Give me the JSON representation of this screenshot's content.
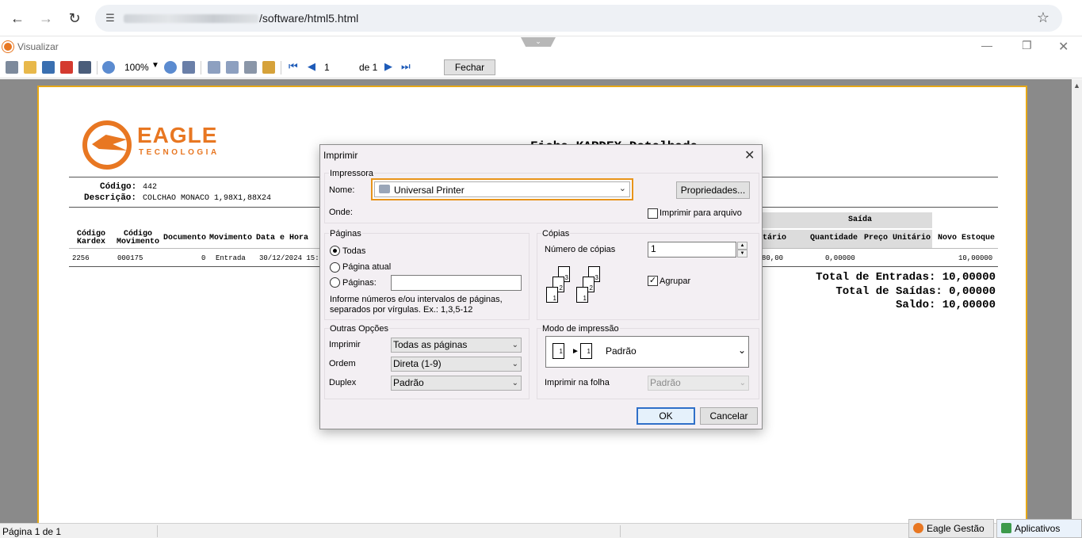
{
  "browser": {
    "url_visible": "/software/html5.html"
  },
  "app": {
    "window_title": "Visualizar"
  },
  "toolbar": {
    "zoom": "100%",
    "page_current": "1",
    "page_of": "de 1",
    "close_label": "Fechar"
  },
  "report": {
    "logo_word": "EAGLE",
    "logo_sub": "TECNOLOGIA",
    "title": "Ficha KARDEX Detalhada",
    "codigo_label": "Código:",
    "codigo_value": "442",
    "descricao_label": "Descrição:",
    "descricao_value": "COLCHAO MONACO 1,98X1,88X24",
    "band_saida": "Saída",
    "headers": {
      "codigo_kardex": "Código Kardex",
      "codigo_movimento": "Código Movimento",
      "documento": "Documento",
      "movimento": "Movimento",
      "data_hora": "Data e Hora",
      "unitario": "tário",
      "quantidade": "Quantidade",
      "preco_unitario": "Preço Unitário",
      "novo_estoque": "Novo Estoque"
    },
    "row": {
      "codigo_kardex": "2256",
      "codigo_movimento": "000175",
      "documento": "0",
      "movimento": "Entrada",
      "data_hora": "30/12/2024 15:",
      "unitario": "80,00",
      "quantidade": "0,00000",
      "novo_estoque": "10,00000"
    },
    "totals": {
      "entradas": "Total de Entradas: 10,00000",
      "saidas": "Total de Saídas: 0,00000",
      "saldo": "Saldo: 10,00000"
    }
  },
  "dialog": {
    "title": "Imprimir",
    "impressora_group": "Impressora",
    "nome_label": "Nome:",
    "printer_name": "Universal Printer",
    "propriedades_label": "Propriedades...",
    "onde_label": "Onde:",
    "imprimir_arquivo_label": "Imprimir para arquivo",
    "paginas_group": "Páginas",
    "todas_label": "Todas",
    "pagina_atual_label": "Página atual",
    "paginas_label": "Páginas:",
    "paginas_value": "",
    "paginas_hint": "Informe números e/ou intervalos de páginas, separados por vírgulas. Ex.: 1,3,5-12",
    "copias_group": "Cópias",
    "numero_copias_label": "Número de cópias",
    "numero_copias_value": "1",
    "agrupar_label": "Agrupar",
    "outras_group": "Outras Opções",
    "imprimir_label": "Imprimir",
    "imprimir_value": "Todas as páginas",
    "ordem_label": "Ordem",
    "ordem_value": "Direta (1-9)",
    "duplex_label": "Duplex",
    "duplex_value": "Padrão",
    "modo_group": "Modo de impressão",
    "modo_value": "Padrão",
    "imprimir_folha_label": "Imprimir na folha",
    "imprimir_folha_value": "Padrão",
    "ok_label": "OK",
    "cancel_label": "Cancelar"
  },
  "status": {
    "page_info": "Página 1 de 1"
  },
  "taskbar": {
    "item1": "Eagle Gestão ...",
    "item2": "Aplicativos"
  }
}
